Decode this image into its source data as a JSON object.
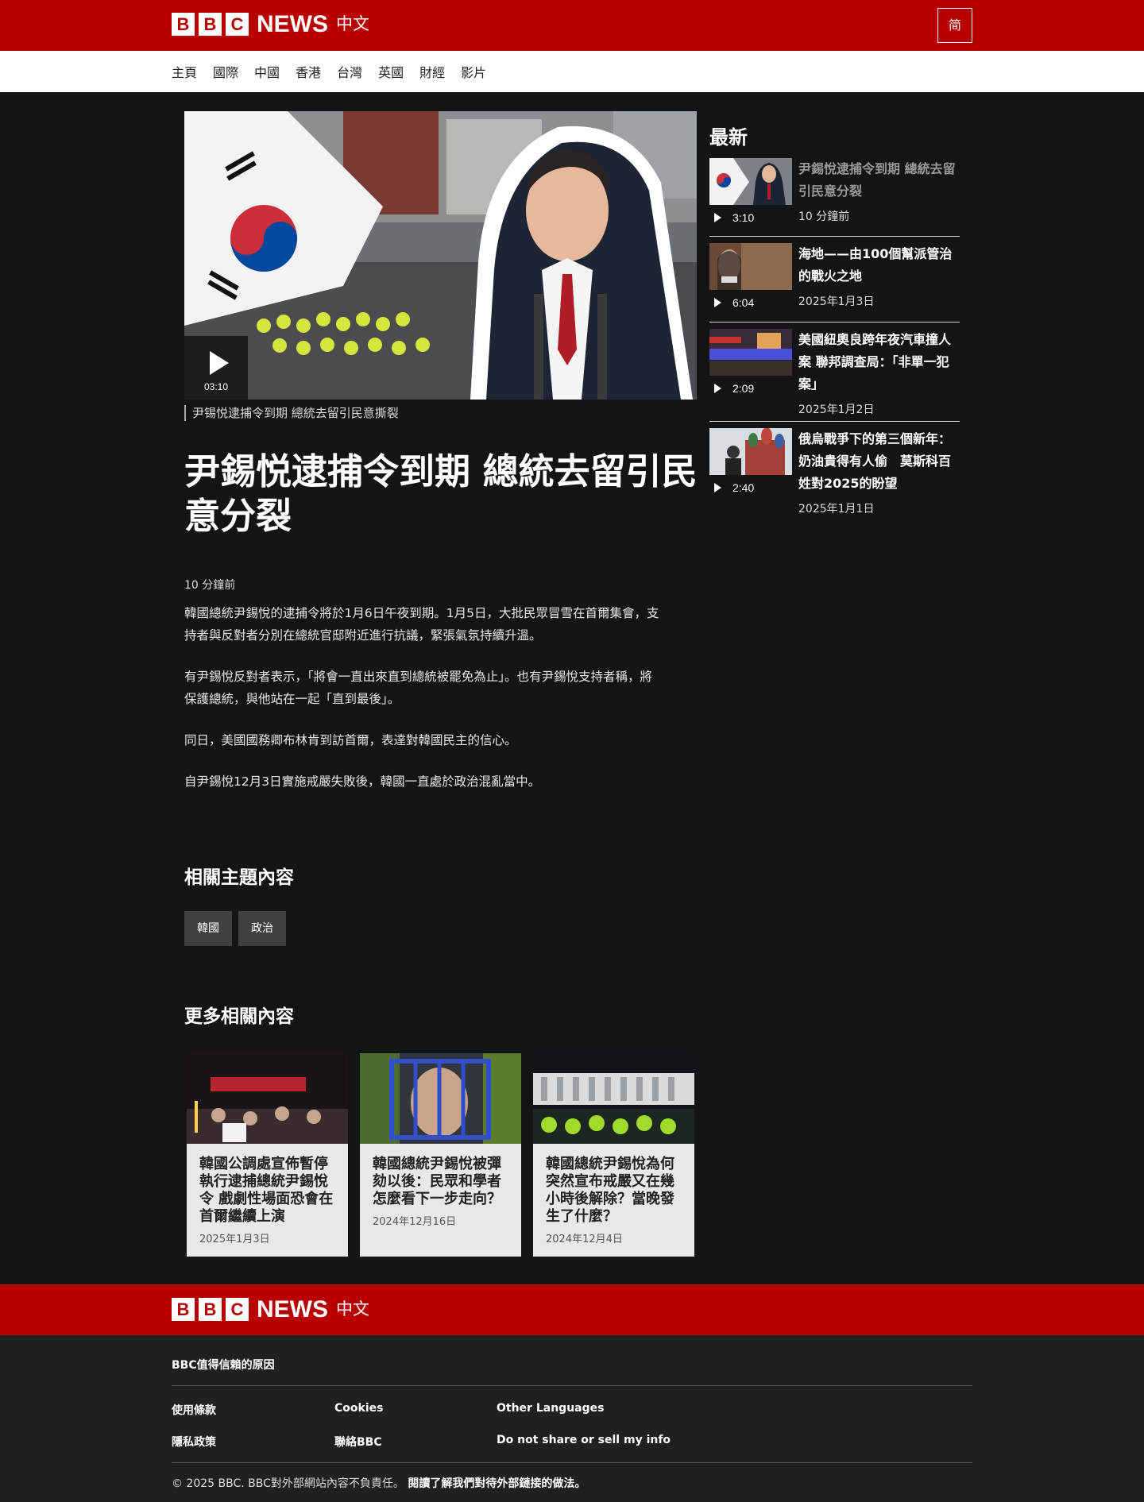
{
  "header": {
    "logo_letters": [
      "B",
      "B",
      "C"
    ],
    "logo_news": "NEWS",
    "logo_language": "中文",
    "script_toggle": "简"
  },
  "nav": {
    "items": [
      "主頁",
      "國際",
      "中國",
      "香港",
      "台灣",
      "英國",
      "財經",
      "影片"
    ]
  },
  "video": {
    "duration": "03:10",
    "caption": "尹锡悦逮捕令到期 總統去留引民意撕裂"
  },
  "article": {
    "headline": "尹錫悦逮捕令到期 總統去留引民意分裂",
    "timestamp": "10 分鐘前",
    "paragraphs": [
      "韓國總統尹錫悅的逮捕令將於1月6日午夜到期。1月5日，大批民眾冒雪在首爾集會，支持者與反對者分別在總統官邸附近進行抗議，緊張氣氛持續升溫。",
      "有尹錫悅反對者表示，「將會一直出來直到總統被罷免為止」。也有尹錫悅支持者稱，將保護總統，與他站在一起「直到最後」。",
      "同日，美國國務卿布林肯到訪首爾，表達對韓國民主的信心。",
      "自尹錫悅12月3日實施戒嚴失敗後，韓國一直處於政治混亂當中。"
    ]
  },
  "topics": {
    "title": "相關主題內容",
    "tags": [
      "韓國",
      "政治"
    ]
  },
  "more": {
    "title": "更多相關內容",
    "cards": [
      {
        "title": "韓國公調處宣佈暫停執行逮捕總統尹錫悅令 戲劇性場面恐會在首爾繼續上演",
        "date": "2025年1月3日"
      },
      {
        "title": "韓國總統尹錫悅被彈劾以後：民眾和學者怎麼看下一步走向？",
        "date": "2024年12月16日"
      },
      {
        "title": "韓國總統尹錫悅為何突然宣布戒嚴又在幾小時後解除？當晚發生了什麼？",
        "date": "2024年12月4日"
      }
    ]
  },
  "latest": {
    "title": "最新",
    "items": [
      {
        "title": "尹錫悅逮捕令到期 總統去留引民意分裂",
        "duration": "3:10",
        "date": "10 分鐘前"
      },
      {
        "title": "海地——由100個幫派管治的戰火之地",
        "duration": "6:04",
        "date": "2025年1月3日"
      },
      {
        "title": "美國紐奧良跨年夜汽車撞人案 聯邦調查局：「非單一犯案」",
        "duration": "2:09",
        "date": "2025年1月2日"
      },
      {
        "title": "俄烏戰爭下的第三個新年：奶油貴得有人偷　莫斯科百姓對2025的盼望",
        "duration": "2:40",
        "date": "2025年1月1日"
      }
    ]
  },
  "footer": {
    "trust_link": "BBC值得信賴的原因",
    "links": [
      "使用條款",
      "Cookies",
      "Other Languages",
      "隱私政策",
      "聯絡BBC",
      "Do not share or sell my info"
    ],
    "copyright": "© 2025 BBC. BBC對外部網站內容不負責任。",
    "external_link": "閱讀了解我們對待外部鏈接的做法。"
  }
}
